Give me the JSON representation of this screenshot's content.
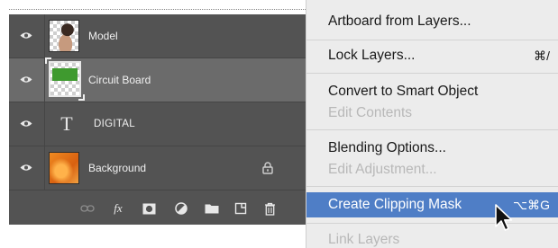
{
  "layers_panel": {
    "layers": [
      {
        "name": "Model",
        "thumb": "model-photo",
        "visible": true,
        "selected": false
      },
      {
        "name": "Circuit Board",
        "thumb": "circuit-board",
        "visible": true,
        "selected": true
      },
      {
        "name": "DIGITAL",
        "thumb": "type-layer",
        "type_glyph": "T",
        "visible": true,
        "selected": false
      },
      {
        "name": "Background",
        "thumb": "orange-background",
        "visible": true,
        "selected": false,
        "locked": true
      }
    ],
    "footer_icons": [
      "link-icon",
      "fx-icon",
      "mask-icon",
      "adjustment-icon",
      "folder-icon",
      "new-layer-icon",
      "trash-icon"
    ],
    "fx_label": "fx"
  },
  "context_menu": {
    "items": [
      {
        "label": "Artboard from Layers...",
        "enabled": true
      },
      {
        "label": "Lock Layers...",
        "shortcut": "⌘/",
        "enabled": true
      },
      {
        "label": "Convert to Smart Object",
        "enabled": true
      },
      {
        "label": "Edit Contents",
        "enabled": false
      },
      {
        "label": "Blending Options...",
        "enabled": true
      },
      {
        "label": "Edit Adjustment...",
        "enabled": false
      },
      {
        "label": "Create Clipping Mask",
        "shortcut": "⌥⌘G",
        "enabled": true,
        "highlighted": true
      },
      {
        "label": "Link Layers",
        "enabled": false
      }
    ]
  },
  "colors": {
    "panel_bg": "#535353",
    "selected_row": "#6b6b6b",
    "menu_bg": "#ececec",
    "menu_highlight": "#4f7ec6"
  }
}
